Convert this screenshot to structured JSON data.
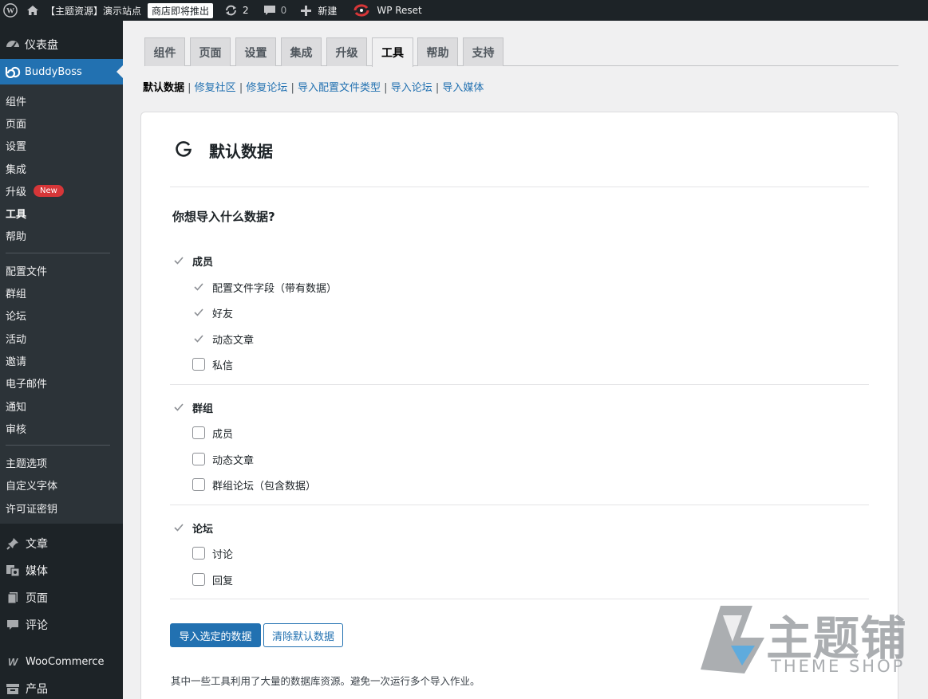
{
  "adminbar": {
    "site_name": "【主题资源】演示站点",
    "store_badge": "商店即将推出",
    "updates_count": "2",
    "comments_count": "0",
    "new_label": "新建",
    "wp_reset_label": "WP Reset"
  },
  "sidebar": {
    "dashboard": "仪表盘",
    "plugin": "BuddyBoss",
    "sub_items": [
      {
        "label": "组件"
      },
      {
        "label": "页面"
      },
      {
        "label": "设置"
      },
      {
        "label": "集成"
      },
      {
        "label": "升级",
        "badge": "New"
      },
      {
        "label": "工具"
      },
      {
        "label": "帮助"
      },
      {
        "label": "配置文件"
      },
      {
        "label": "群组"
      },
      {
        "label": "论坛"
      },
      {
        "label": "活动"
      },
      {
        "label": "邀请"
      },
      {
        "label": "电子邮件"
      },
      {
        "label": "通知"
      },
      {
        "label": "审核"
      },
      {
        "label": "主题选项"
      },
      {
        "label": "自定义字体"
      },
      {
        "label": "许可证密钥"
      }
    ],
    "main_items": [
      "文章",
      "媒体",
      "页面",
      "评论",
      "WooCommerce",
      "产品"
    ]
  },
  "tabs": [
    "组件",
    "页面",
    "设置",
    "集成",
    "升级",
    "工具",
    "帮助",
    "支持"
  ],
  "active_tab": "工具",
  "subnav": {
    "current": "默认数据",
    "links": [
      "修复社区",
      "修复论坛",
      "导入配置文件类型",
      "导入论坛",
      "导入媒体"
    ]
  },
  "panel": {
    "title": "默认数据",
    "question": "你想导入什么数据?",
    "groups": [
      {
        "label": "成员",
        "checked": true,
        "items": [
          {
            "label": "配置文件字段（带有数据）",
            "checked": true
          },
          {
            "label": "好友",
            "checked": true
          },
          {
            "label": "动态文章",
            "checked": true
          },
          {
            "label": "私信",
            "checked": false
          }
        ]
      },
      {
        "label": "群组",
        "checked": true,
        "items": [
          {
            "label": "成员",
            "checked": false
          },
          {
            "label": "动态文章",
            "checked": false
          },
          {
            "label": "群组论坛（包含数据）",
            "checked": false
          }
        ]
      },
      {
        "label": "论坛",
        "checked": true,
        "items": [
          {
            "label": "讨论",
            "checked": false
          },
          {
            "label": "回复",
            "checked": false
          }
        ]
      }
    ],
    "import_button": "导入选定的数据",
    "clear_button": "清除默认数据",
    "note": "其中一些工具利用了大量的数据库资源。避免一次运行多个导入作业。"
  },
  "watermark": {
    "cn": "主题铺",
    "en": "THEME SHOP"
  },
  "colors": {
    "accent": "#2271b1",
    "sidebar_bg": "#1d2327",
    "badge": "#d63638"
  }
}
